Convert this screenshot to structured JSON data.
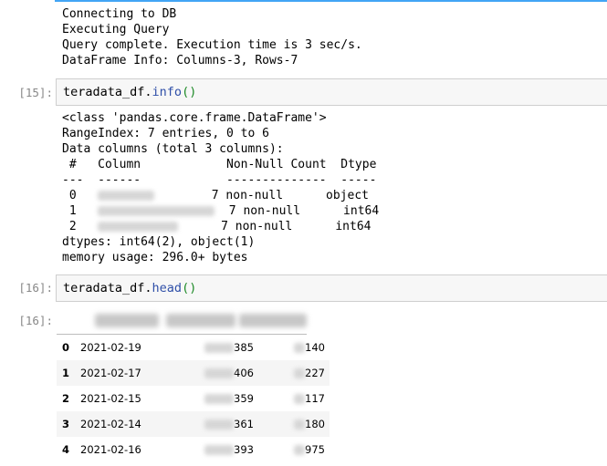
{
  "cell14_output": {
    "lines": [
      "Connecting to DB",
      "Executing Query",
      "Query complete. Execution time is 3 sec/s.",
      "DataFrame Info: Columns-3, Rows-7"
    ]
  },
  "cell15": {
    "prompt_in": "[15]:",
    "code_obj": "teradata_df.",
    "code_func": "info",
    "code_paren": "()",
    "output": {
      "line1": "<class 'pandas.core.frame.DataFrame'>",
      "line2": "RangeIndex: 7 entries, 0 to 6",
      "line3": "Data columns (total 3 columns):",
      "hdr_hash": " #",
      "hdr_column": "Column",
      "hdr_nonnull": "Non-Null Count",
      "hdr_dtype": "Dtype",
      "sep_hash": "---",
      "sep_column": "------",
      "sep_nonnull": "--------------",
      "sep_dtype": "-----",
      "rows": [
        {
          "idx": " 0",
          "nonnull": "7 non-null",
          "dtype": "object"
        },
        {
          "idx": " 1",
          "nonnull": "7 non-null",
          "dtype": "int64"
        },
        {
          "idx": " 2",
          "nonnull": "7 non-null",
          "dtype": "int64"
        }
      ],
      "dtypes": "dtypes: int64(2), object(1)",
      "memory": "memory usage: 296.0+ bytes"
    }
  },
  "cell16": {
    "prompt_in": "[16]:",
    "prompt_out": "[16]:",
    "code_obj": "teradata_df.",
    "code_func": "head",
    "code_paren": "()",
    "table_rows": [
      {
        "idx": "0",
        "date": "2021-02-19",
        "v1_tail": "385",
        "v2_tail": "140"
      },
      {
        "idx": "1",
        "date": "2021-02-17",
        "v1_tail": "406",
        "v2_tail": "227"
      },
      {
        "idx": "2",
        "date": "2021-02-15",
        "v1_tail": "359",
        "v2_tail": "117"
      },
      {
        "idx": "3",
        "date": "2021-02-14",
        "v1_tail": "361",
        "v2_tail": "180"
      },
      {
        "idx": "4",
        "date": "2021-02-16",
        "v1_tail": "393",
        "v2_tail": "975"
      }
    ]
  }
}
